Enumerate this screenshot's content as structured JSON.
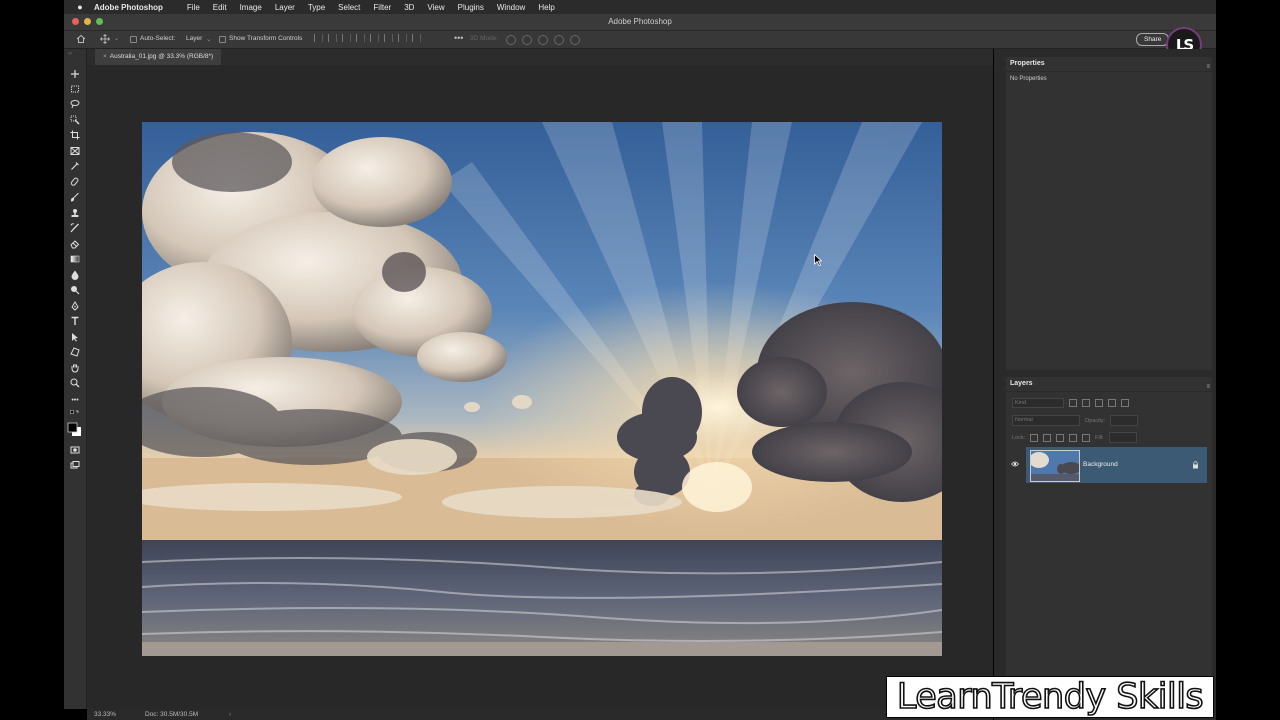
{
  "menubar": {
    "app_name": "Adobe Photoshop",
    "items": [
      "File",
      "Edit",
      "Image",
      "Layer",
      "Type",
      "Select",
      "Filter",
      "3D",
      "View",
      "Plugins",
      "Window",
      "Help"
    ]
  },
  "window": {
    "title": "Adobe Photoshop"
  },
  "options_bar": {
    "auto_select_label": "Auto-Select:",
    "auto_select_value": "Layer",
    "show_transform_label": "Show Transform Controls",
    "mode_3d_label": "3D Mode:",
    "share_label": "Share"
  },
  "logo": {
    "text": "LS"
  },
  "document": {
    "tab_label": "Australia_01.jpg @ 33.3% (RGB/8*)",
    "tab_close": "×"
  },
  "status_bar": {
    "zoom": "33.33%",
    "doc_info": "Doc: 30.5M/30.5M",
    "arrow": "›"
  },
  "properties_panel": {
    "title": "Properties",
    "empty_text": "No Properties"
  },
  "layers_panel": {
    "title": "Layers",
    "kind_placeholder": "Kind",
    "blend_mode": "Normal",
    "opacity_label": "Opacity:",
    "lock_label": "Lock:",
    "fill_label": "Fill:",
    "layers": [
      {
        "name": "Background",
        "locked": true,
        "visible": true
      }
    ]
  },
  "watermark": {
    "text": "LearnTrendy Skills"
  },
  "colors": {
    "accent_selected_layer": "#3c5a73",
    "panel_bg": "#323232",
    "canvas_bg": "#282828"
  }
}
